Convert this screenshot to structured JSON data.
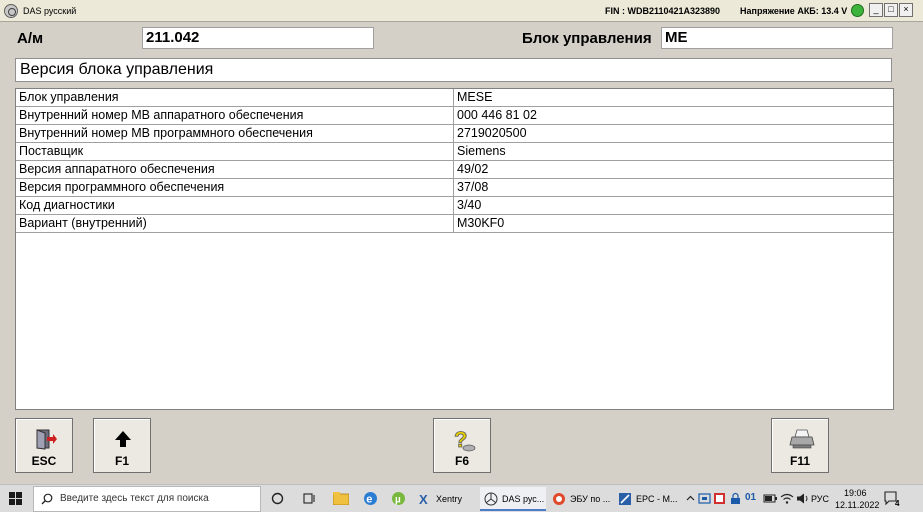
{
  "window": {
    "title": "DAS русский",
    "fin": "FIN : WDB2110421A323890",
    "battery": "Напряжение АКБ: 13.4 V",
    "controls": [
      "_",
      "□",
      "×"
    ]
  },
  "header": {
    "model_label": "А/м",
    "model_value": "211.042",
    "ecu_label": "Блок управления",
    "ecu_value": "ME"
  },
  "section_title": "Версия блока управления",
  "table": {
    "rows": [
      {
        "key": "Блок управления",
        "value": "MESE"
      },
      {
        "key": "Внутренний номер MB аппаратного обеспечения",
        "value": "000 446 81 02"
      },
      {
        "key": "Внутренний номер MB программного обеспечения",
        "value": "2719020500"
      },
      {
        "key": "Поставщик",
        "value": "Siemens"
      },
      {
        "key": "Версия аппаратного обеспечения",
        "value": "49/02"
      },
      {
        "key": "Версия программного обеспечения",
        "value": "37/08"
      },
      {
        "key": "Код диагностики",
        "value": "3/40"
      },
      {
        "key": "Вариант (внутренний)",
        "value": "M30KF0"
      }
    ]
  },
  "function_keys": [
    {
      "label": "ESC",
      "icon": "exit-door-icon"
    },
    {
      "label": "F1",
      "icon": "arrow-up-icon"
    },
    {
      "label": "F6",
      "icon": "help-question-icon"
    },
    {
      "label": "F11",
      "icon": "printer-icon"
    }
  ],
  "taskbar": {
    "search_placeholder": "Введите здесь текст для поиска",
    "items": [
      {
        "label": "Xentry",
        "icon": "xentry-icon"
      },
      {
        "label": "DAS рус...",
        "icon": "mercedes-star-icon"
      },
      {
        "label": "ЭБУ по ...",
        "icon": "browser-icon"
      },
      {
        "label": "EPC - M...",
        "icon": "epc-icon"
      }
    ],
    "tray_badge": "01",
    "language": "РУС",
    "time": "19:06",
    "date": "12.11.2022",
    "notification_count": "4",
    "colors": {
      "accent": "#4a7cc8",
      "ok_indicator": "#3cb43c"
    }
  }
}
